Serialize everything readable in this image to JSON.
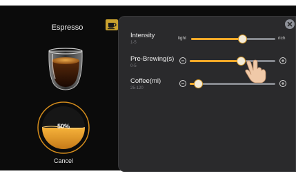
{
  "drink": {
    "name": "Espresso",
    "progress_text": "50%",
    "progress_value": 0.5,
    "cancel_label": "Cancel"
  },
  "panel": {
    "params": [
      {
        "title": "Intensity",
        "range": "1-5",
        "left_label": "light",
        "right_label": "rich",
        "value_fraction": 0.61
      },
      {
        "title": "Pre-Brewing(s)",
        "range": "0-5",
        "value_fraction": 0.6
      },
      {
        "title": "Coffee(ml)",
        "range": "25-120",
        "value_fraction": 0.1
      }
    ]
  },
  "colors": {
    "accent": "#f2a928",
    "panel_bg": "#2a2a2c",
    "screen_bg": "#0b0b0b",
    "track": "#85888e"
  },
  "icons": {
    "close": "close-icon",
    "coffee_cup": "coffee-cup-icon",
    "minus": "minus-icon",
    "plus": "plus-icon",
    "hand": "hand-pointer-icon"
  }
}
